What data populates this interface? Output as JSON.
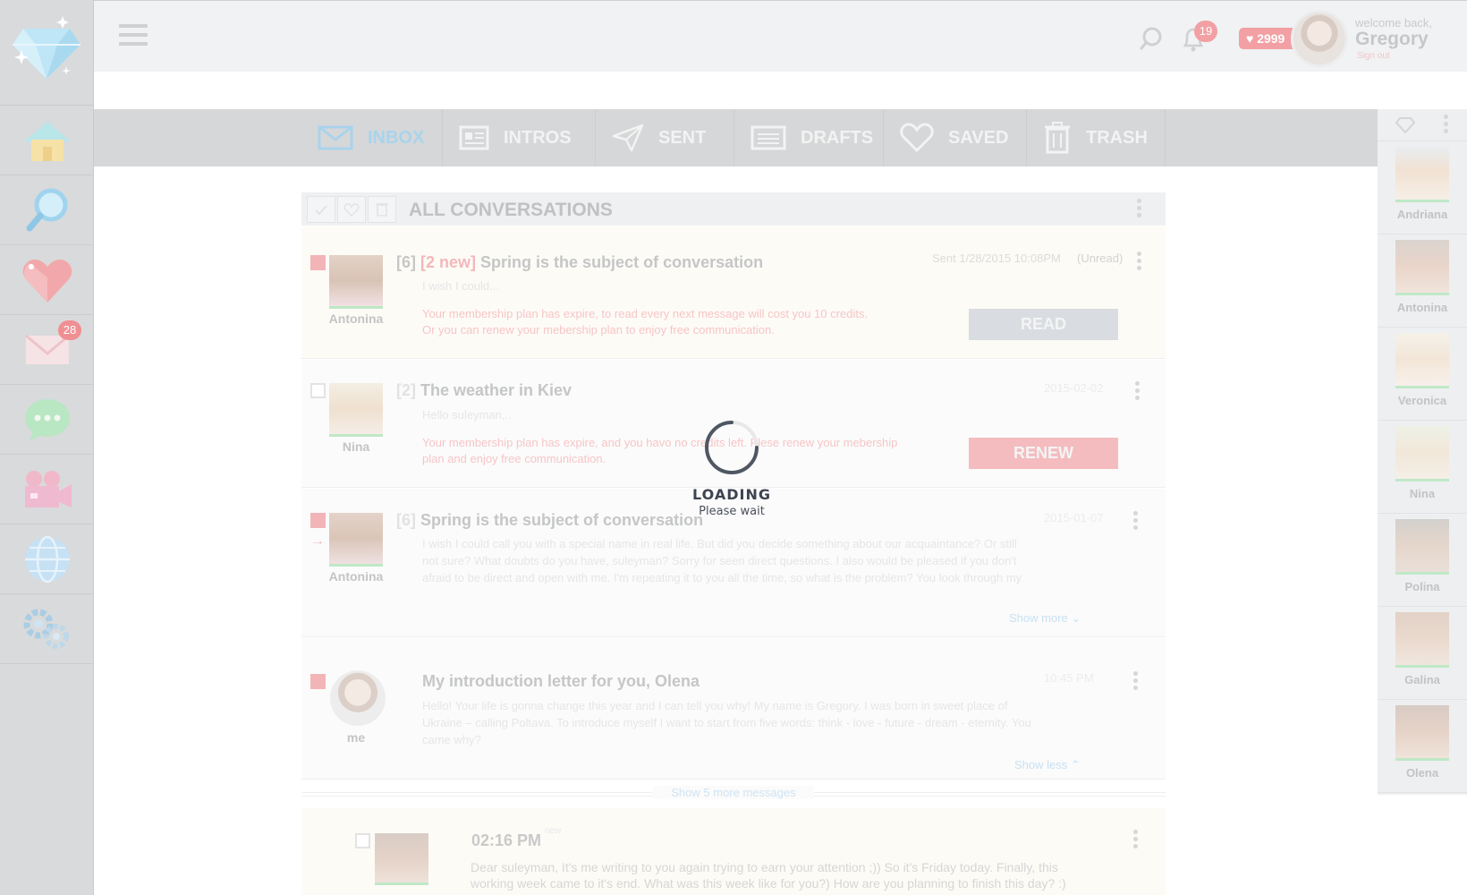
{
  "header": {
    "notification_count": "19",
    "credits": "2999",
    "welcome": "welcome back,",
    "user_name": "Gregory",
    "sign_out": "Sign out"
  },
  "sidebar": {
    "items": [
      {
        "name": "home",
        "icon": "house-icon"
      },
      {
        "name": "search",
        "icon": "magnifier-icon"
      },
      {
        "name": "favorites",
        "icon": "heart-icon"
      },
      {
        "name": "mail",
        "icon": "envelope-icon",
        "badge": "28"
      },
      {
        "name": "chat",
        "icon": "chat-bubble-icon"
      },
      {
        "name": "video",
        "icon": "video-camera-icon"
      },
      {
        "name": "globe",
        "icon": "globe-icon"
      },
      {
        "name": "settings",
        "icon": "gear-icon"
      }
    ]
  },
  "tabs": [
    {
      "label": "INBOX",
      "icon": "envelope-icon",
      "active": true
    },
    {
      "label": "INTROS",
      "icon": "intro-card-icon"
    },
    {
      "label": "SENT",
      "icon": "paper-plane-icon"
    },
    {
      "label": "DRAFTS",
      "icon": "draft-icon"
    },
    {
      "label": "SAVED",
      "icon": "heart-outline-icon"
    },
    {
      "label": "TRASH",
      "icon": "trash-icon"
    }
  ],
  "list": {
    "title": "ALL CONVERSATIONS",
    "rows": [
      {
        "name": "Antonina",
        "count": "[6]",
        "new_tag": "[2 new]",
        "subject": "Spring is the subject of conversation",
        "meta": "Sent 1/28/2015 10:08PM",
        "status": "(Unread)",
        "preview": "I wish I could...",
        "warning_1": "Your membership plan has expire, to read every next message will cost you 10 credits.",
        "warning_2": "Or you can renew your mebership plan to enjoy free communication.",
        "button": "READ"
      },
      {
        "name": "Nina",
        "count": "[2]",
        "subject": "The weather in Kiev",
        "meta": "2015-02-02",
        "preview": "Hello suleyman,..",
        "warning_1": "Your membership plan has expire, and you havo no credits left. Plese renew your mebership",
        "warning_2": "plan and enjoy free communication.",
        "button": "RENEW"
      },
      {
        "name": "Antonina",
        "count": "[6]",
        "subject": "Spring is the subject of conversation",
        "meta": "2015-01-07",
        "preview_1": "I wish I could call you with a special name in real life. But did you decide something about our acquaintance? Or still",
        "preview_2": "not sure? What doubts do you have, suleyman? Sorry for seen direct questions. I also would be pleased if you don't",
        "preview_3": "afraid to be direct and open with me. I'm repeating it to you all the time, so what is the problem? You look through my",
        "more": "Show more"
      },
      {
        "name": "me",
        "subject": "My introduction letter for you, Olena",
        "meta": "10:45 PM",
        "preview_1": "Hello! Your life is gonna change this year and I can tell you why! My name is Gregory. I was born in sweet place of",
        "preview_2": "Ukraine – calling Poltava. To introduce myself I want to start from five words: think - love - future - dream - eternity. You",
        "preview_3": "came why?",
        "less": "Show less"
      }
    ],
    "show_more_messages": "Show 5 more messages",
    "last": {
      "time": "02:16 PM",
      "new_tag": "new",
      "text_1": "Dear suleyman, It's me writing to you again trying to earn your attention ;)) So it's Friday today. Finally, this",
      "text_2": "working week came to it's end. What was this week like for you?) How are you planning to finish this day? :)"
    }
  },
  "right_panel": {
    "people": [
      "Andriana",
      "Antonina",
      "Veronica",
      "Nina",
      "Polina",
      "Galina",
      "Olena"
    ]
  },
  "loader": {
    "title": "LOADING",
    "subtitle": "Please wait"
  }
}
